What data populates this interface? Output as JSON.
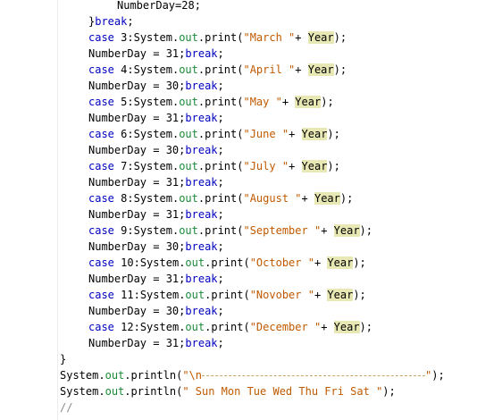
{
  "code": {
    "l0": "NumberDay=28;",
    "l1_brace": "}",
    "l1_kw": "break",
    "semicolon": ";",
    "case_kw": "case",
    "break_kw": "break",
    "system": "System",
    "out": "out",
    "print": "print",
    "println": "println",
    "year": "Year",
    "cases": [
      {
        "num": "3",
        "month": "\"March \"",
        "days": "31"
      },
      {
        "num": "4",
        "month": "\"April \"",
        "days": "30"
      },
      {
        "num": "5",
        "month": "\"May \"",
        "days": "31"
      },
      {
        "num": "6",
        "month": "\"June \"",
        "days": "30"
      },
      {
        "num": "7",
        "month": "\"July \"",
        "days": "31"
      },
      {
        "num": "8",
        "month": "\"August \"",
        "days": "31"
      },
      {
        "num": "9",
        "month": "\"September \"",
        "days": "30"
      },
      {
        "num": "10",
        "month": "\"October \"",
        "days": "31"
      },
      {
        "num": "11",
        "month": "\"Novober \"",
        "days": "30"
      },
      {
        "num": "12",
        "month": "\"December \"",
        "days": "31"
      }
    ],
    "close_brace": "}",
    "println1_str_open": "\"\\n",
    "println1_str_close": "\"",
    "println2_str": "\" Sun Mon Tue Wed Thu Fri Sat \"",
    "comment": "//"
  }
}
